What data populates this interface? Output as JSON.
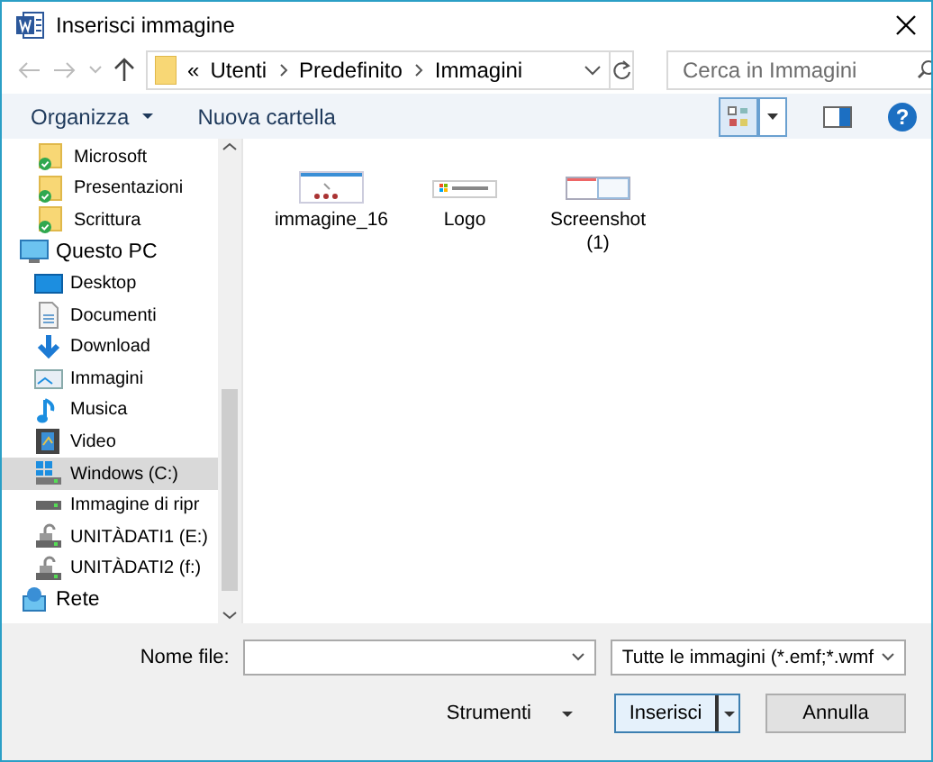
{
  "window": {
    "title": "Inserisci immagine"
  },
  "address": {
    "overflow": "«",
    "crumbs": [
      "Utenti",
      "Predefinito",
      "Immagini"
    ]
  },
  "search": {
    "placeholder": "Cerca in Immagini"
  },
  "toolbar": {
    "organize": "Organizza",
    "new_folder": "Nuova cartella",
    "help": "?"
  },
  "sidebar": {
    "items": [
      {
        "label": "Microsoft",
        "kind": "synced-folder",
        "selected": false
      },
      {
        "label": "Presentazioni",
        "kind": "synced-folder",
        "selected": false
      },
      {
        "label": "Scrittura",
        "kind": "synced-folder",
        "selected": false
      },
      {
        "label": "Questo PC",
        "kind": "pc",
        "selected": false,
        "children": [
          {
            "label": "Desktop",
            "kind": "desktop",
            "selected": false
          },
          {
            "label": "Documenti",
            "kind": "documents",
            "selected": false
          },
          {
            "label": "Download",
            "kind": "download",
            "selected": false
          },
          {
            "label": "Immagini",
            "kind": "pictures",
            "selected": false
          },
          {
            "label": "Musica",
            "kind": "music",
            "selected": false
          },
          {
            "label": "Video",
            "kind": "video",
            "selected": false
          },
          {
            "label": "Windows (C:)",
            "kind": "system-drive",
            "selected": true
          },
          {
            "label": "Immagine di ripr",
            "kind": "drive",
            "selected": false
          },
          {
            "label": "UNITÀDATI1 (E:)",
            "kind": "locked-drive",
            "selected": false
          },
          {
            "label": "UNITÀDATI2 (f:)",
            "kind": "locked-drive",
            "selected": false
          }
        ]
      },
      {
        "label": "Rete",
        "kind": "network",
        "selected": false
      }
    ]
  },
  "files": [
    {
      "name": "immagine_16",
      "kind": "diagram"
    },
    {
      "name": "Logo",
      "kind": "logo"
    },
    {
      "name": "Screenshot (1)",
      "kind": "window"
    }
  ],
  "footer": {
    "filename_label": "Nome file:",
    "filetype": "Tutte le immagini (*.emf;*.wmf",
    "tools": "Strumenti",
    "insert": "Inserisci",
    "cancel": "Annulla"
  }
}
